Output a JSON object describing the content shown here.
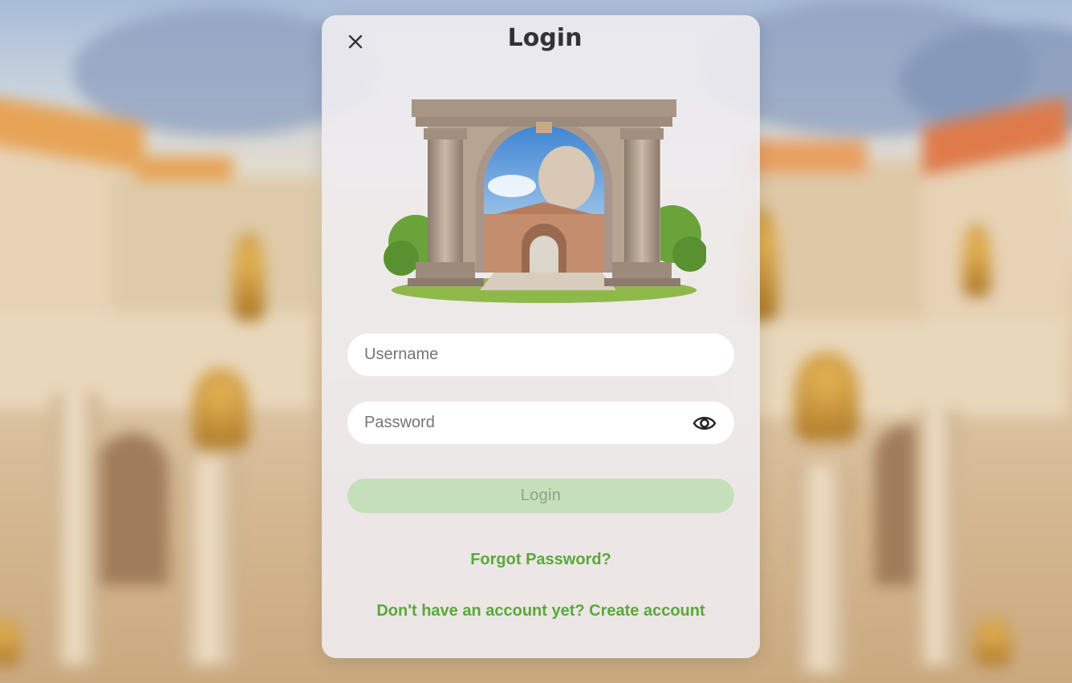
{
  "dialog": {
    "title": "Login",
    "close_icon": "close-icon",
    "hero_image": "roman-arch-illustration"
  },
  "form": {
    "username_placeholder": "Username",
    "username_value": "",
    "password_placeholder": "Password",
    "password_value": "",
    "password_toggle_icon": "eye-icon",
    "submit_label": "Login",
    "submit_enabled": false
  },
  "links": {
    "forgot_password": "Forgot Password?",
    "create_account": "Don't have an account yet? Create account"
  },
  "colors": {
    "accent": "#5aa83a",
    "button_disabled_bg": "#c6dfbb",
    "button_disabled_text": "#8ea38a",
    "modal_bg": "#eeecf0"
  },
  "background_scene": "blurred-roman-city"
}
